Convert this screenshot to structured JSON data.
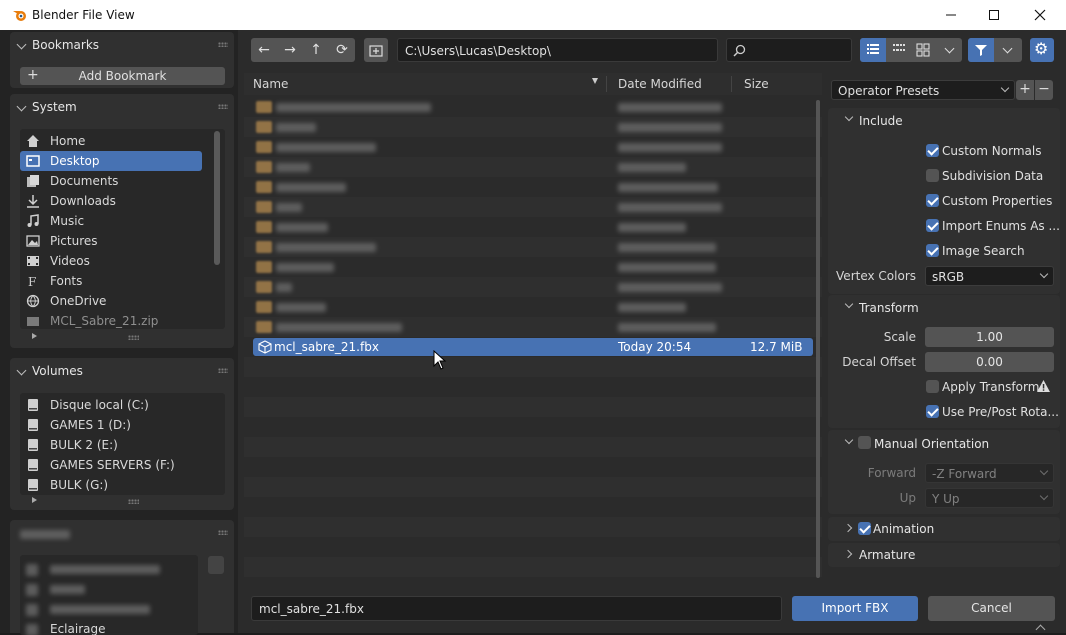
{
  "window": {
    "title": "Blender File View"
  },
  "bookmarks": {
    "title": "Bookmarks",
    "add_label": "Add Bookmark"
  },
  "system": {
    "title": "System",
    "items": [
      {
        "label": "Home",
        "icon": "home-icon"
      },
      {
        "label": "Desktop",
        "icon": "desktop-icon",
        "selected": true
      },
      {
        "label": "Documents",
        "icon": "documents-icon"
      },
      {
        "label": "Downloads",
        "icon": "downloads-icon"
      },
      {
        "label": "Music",
        "icon": "music-icon"
      },
      {
        "label": "Pictures",
        "icon": "pictures-icon"
      },
      {
        "label": "Videos",
        "icon": "videos-icon"
      },
      {
        "label": "Fonts",
        "icon": "fonts-icon"
      },
      {
        "label": "OneDrive",
        "icon": "onedrive-icon"
      },
      {
        "label": "MCL_Sabre_21.zip",
        "icon": "zip-icon"
      }
    ]
  },
  "volumes": {
    "title": "Volumes",
    "items": [
      {
        "label": "Disque local (C:)"
      },
      {
        "label": "GAMES 1 (D:)"
      },
      {
        "label": "BULK 2 (E:)"
      },
      {
        "label": "GAMES SERVERS (F:)"
      },
      {
        "label": "BULK (G:)"
      }
    ]
  },
  "recent": {
    "partial_label": "Eclairage"
  },
  "path": {
    "value": "C:\\Users\\Lucas\\Desktop\\"
  },
  "search": {
    "placeholder": ""
  },
  "columns": {
    "name": "Name",
    "date": "Date Modified",
    "size": "Size"
  },
  "selected_file": {
    "name": "mcl_sabre_21.fbx",
    "date": "Today 20:54",
    "size": "12.7 MiB"
  },
  "filename": {
    "value": "mcl_sabre_21.fbx"
  },
  "buttons": {
    "import": "Import FBX",
    "cancel": "Cancel"
  },
  "colors": {
    "accent": "#4772b3",
    "background": "#2b2b2b",
    "panel": "#303030",
    "field": "#1d1d1d"
  },
  "operator_presets": {
    "label": "Operator Presets"
  },
  "include": {
    "title": "Include",
    "custom_normals": {
      "label": "Custom Normals",
      "checked": true
    },
    "subdivision_data": {
      "label": "Subdivision Data",
      "checked": false
    },
    "custom_properties": {
      "label": "Custom Properties",
      "checked": true
    },
    "import_enums": {
      "label": "Import Enums As ...",
      "checked": true
    },
    "image_search": {
      "label": "Image Search",
      "checked": true
    },
    "vertex_colors": {
      "label": "Vertex Colors",
      "value": "sRGB"
    }
  },
  "transform": {
    "title": "Transform",
    "scale": {
      "label": "Scale",
      "value": "1.00"
    },
    "decal_offset": {
      "label": "Decal Offset",
      "value": "0.00"
    },
    "apply_transform": {
      "label": "Apply Transform",
      "checked": false
    },
    "use_prepost": {
      "label": "Use Pre/Post Rota...",
      "checked": true
    }
  },
  "manual_orientation": {
    "title": "Manual Orientation",
    "checked": false,
    "forward": {
      "label": "Forward",
      "value": "-Z Forward"
    },
    "up": {
      "label": "Up",
      "value": "Y Up"
    }
  },
  "animation": {
    "title": "Animation",
    "checked": true
  },
  "armature": {
    "title": "Armature"
  }
}
